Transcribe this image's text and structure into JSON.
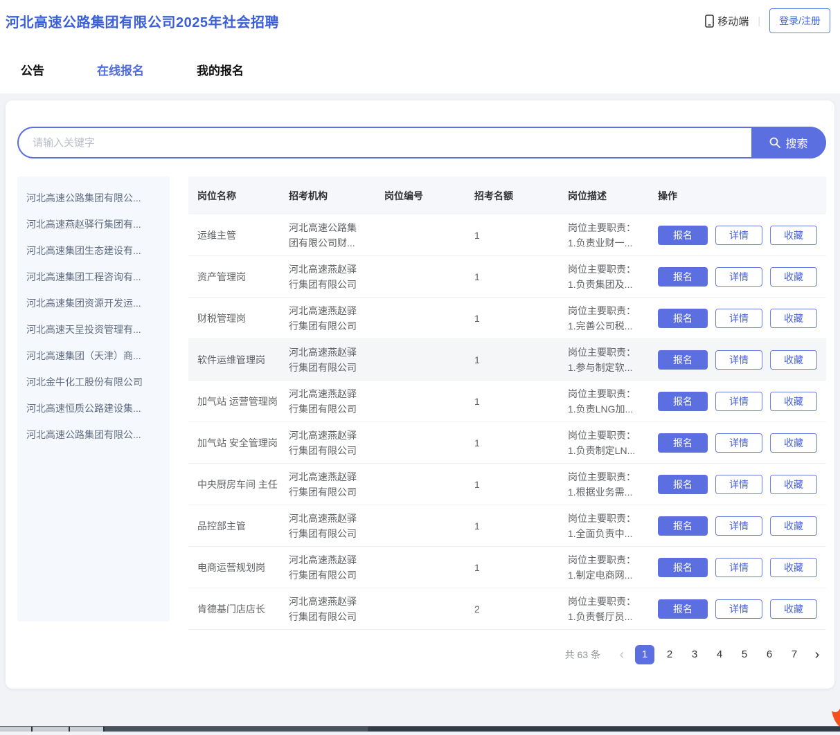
{
  "header": {
    "title": "河北高速公路集团有限公司2025年社会招聘",
    "mobile_label": "移动端",
    "divider": "|",
    "login_label": "登录/注册"
  },
  "tabs": [
    {
      "label": "公告",
      "active": false
    },
    {
      "label": "在线报名",
      "active": true
    },
    {
      "label": "我的报名",
      "active": false
    }
  ],
  "search": {
    "placeholder": "请输入关键字",
    "button_label": "搜索",
    "icon": "search-icon"
  },
  "sidebar": {
    "items": [
      "河北高速公路集团有限公...",
      "河北高速燕赵驿行集团有...",
      "河北高速集团生态建设有...",
      "河北高速集团工程咨询有...",
      "河北高速集团资源开发运...",
      "河北高速天呈投资管理有...",
      "河北高速集团（天津）商...",
      "河北金牛化工股份有限公司",
      "河北高速恒质公路建设集...",
      "河北高速公路集团有限公..."
    ]
  },
  "table": {
    "columns": [
      "岗位名称",
      "招考机构",
      "岗位编号",
      "招考名额",
      "岗位描述",
      "操作"
    ],
    "actions": {
      "apply": "报名",
      "detail": "详情",
      "favorite": "收藏"
    },
    "rows": [
      {
        "name": "运维主管",
        "org": "河北高速公路集团有限公司财...",
        "code": "",
        "quota": "1",
        "desc1": "岗位主要职责：",
        "desc2": "1.负责业财一..."
      },
      {
        "name": "资产管理岗",
        "org": "河北高速燕赵驿行集团有限公司",
        "code": "",
        "quota": "1",
        "desc1": "岗位主要职责：",
        "desc2": "1.负责集团及..."
      },
      {
        "name": "财税管理岗",
        "org": "河北高速燕赵驿行集团有限公司",
        "code": "",
        "quota": "1",
        "desc1": "岗位主要职责：",
        "desc2": "1.完善公司税..."
      },
      {
        "name": "软件运维管理岗",
        "org": "河北高速燕赵驿行集团有限公司",
        "code": "",
        "quota": "1",
        "desc1": "岗位主要职责：",
        "desc2": "1.参与制定软..."
      },
      {
        "name": "加气站 运营管理岗",
        "org": "河北高速燕赵驿行集团有限公司",
        "code": "",
        "quota": "1",
        "desc1": "岗位主要职责：",
        "desc2": "1.负责LNG加..."
      },
      {
        "name": "加气站 安全管理岗",
        "org": "河北高速燕赵驿行集团有限公司",
        "code": "",
        "quota": "1",
        "desc1": "岗位主要职责：",
        "desc2": "1.负责制定LN..."
      },
      {
        "name": "中央厨房车间 主任",
        "org": "河北高速燕赵驿行集团有限公司",
        "code": "",
        "quota": "1",
        "desc1": "岗位主要职责：",
        "desc2": "1.根据业务需..."
      },
      {
        "name": "品控部主管",
        "org": "河北高速燕赵驿行集团有限公司",
        "code": "",
        "quota": "1",
        "desc1": "岗位主要职责：",
        "desc2": "1.全面负责中..."
      },
      {
        "name": "电商运营规划岗",
        "org": "河北高速燕赵驿行集团有限公司",
        "code": "",
        "quota": "1",
        "desc1": "岗位主要职责：",
        "desc2": "1.制定电商网..."
      },
      {
        "name": "肯德基门店店长",
        "org": "河北高速燕赵驿行集团有限公司",
        "code": "",
        "quota": "2",
        "desc1": "岗位主要职责：",
        "desc2": "1.负责餐厅员..."
      }
    ]
  },
  "pagination": {
    "total_label": "共 63 条",
    "prev": "‹",
    "next": "›",
    "pages": [
      "1",
      "2",
      "3",
      "4",
      "5",
      "6",
      "7"
    ],
    "active_page": "1"
  },
  "colors": {
    "primary_blue": "#5b6fe0",
    "title_blue": "#3b5fd9",
    "sidebar_bg": "#f5f8fd",
    "table_header_bg": "#f5f7fa",
    "floating_badge_orange": "#f4511e"
  },
  "icons": {
    "mobile": "phone-icon",
    "search": "search-icon",
    "floating_badge": "flame-icon"
  }
}
